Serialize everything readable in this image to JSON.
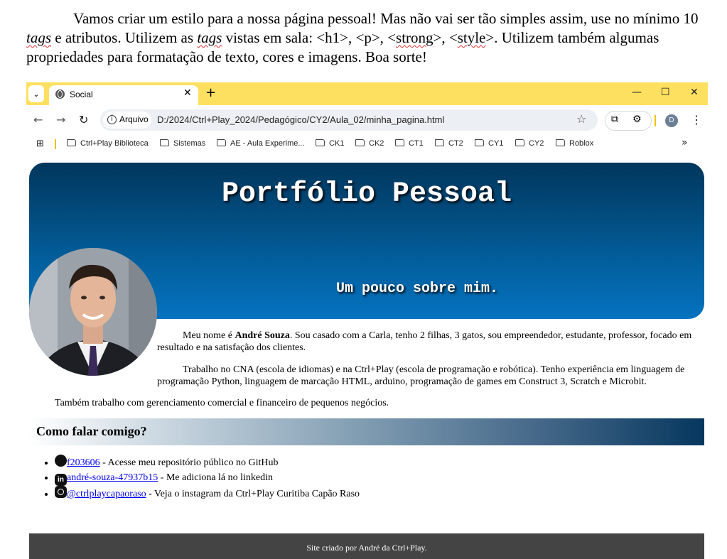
{
  "doc": {
    "text_1": "Vamos criar um estilo para a nossa página pessoal! Mas não vai ser tão simples assim, use no mínimo 10 ",
    "tags_word": "tags",
    "text_2": " e atributos. Utilizem as ",
    "text_3": " vistas em sala:  <h1>, <p>, <",
    "strong_word": "strong",
    "text_4": ">, <",
    "style_word": "style",
    "text_5": ">. Utilizem também algumas propriedades para formatação de texto, cores e imagens. Boa sorte!"
  },
  "browser": {
    "tab_title": "Social",
    "tab_menu_glyph": "⌄",
    "tab_close_glyph": "✕",
    "new_tab_glyph": "+",
    "minimize_glyph": "—",
    "maximize_glyph": "☐",
    "close_glyph": "✕",
    "back_glyph": "←",
    "forward_glyph": "→",
    "reload_glyph": "↻",
    "info_glyph": "i",
    "chip_label": "Arquivo",
    "url": "D:/2024/Ctrl+Play_2024/Pedagógico/CY2/Aula_02/minha_pagina.html",
    "star_glyph": "☆",
    "cast_glyph": "⧉",
    "ext_glyph": "⚙",
    "profile_initial": "D",
    "menu_glyph": "⋮",
    "apps_glyph": "⊞",
    "bookmarks": [
      "Ctrl+Play Biblioteca",
      "Sistemas",
      "AE - Aula Experime...",
      "CK1",
      "CK2",
      "CT1",
      "CT2",
      "CY1",
      "CY2",
      "Roblox"
    ],
    "more_glyph": "»"
  },
  "page": {
    "title": "Portfólio Pessoal",
    "subtitle": "Um pouco sobre mim.",
    "p1_before": "Meu nome é ",
    "p1_name": "André Souza",
    "p1_after": ". Sou casado com a Carla, tenho 2 filhas, 3 gatos, sou empreendedor, estudante, professor, focado em resultado e na satisfação dos clientes.",
    "p2": "Trabalho no CNA (escola de idiomas) e na Ctrl+Play (escola de programação e robótica). Tenho experiência em linguagem de programação Python, linguagem de marcação HTML, arduino, programação de games em Construct 3, Scratch e Microbit.",
    "p3": "Também trabalho com gerenciamento comercial e financeiro de pequenos negócios.",
    "contact_heading": "Como falar comigo?",
    "links": [
      {
        "icon": "github-icon",
        "text": "f203606",
        "desc": " - Acesse meu repositório público no GitHub"
      },
      {
        "icon": "linkedin-icon",
        "glyph": "in",
        "text": "andré-souza-47937b15",
        "desc": " - Me adiciona lá no linkedin"
      },
      {
        "icon": "instagram-icon",
        "text": "@ctrlplaycapaoraso",
        "desc": " - Veja o instagram da Ctrl+Play Curitiba Capão Raso"
      }
    ],
    "footer": "Site criado por André da Ctrl+Play."
  },
  "colors": {
    "tabbar": "#fde060",
    "hero_dark": "#01365c",
    "hero_light": "#0672c0",
    "footer": "#444444"
  }
}
